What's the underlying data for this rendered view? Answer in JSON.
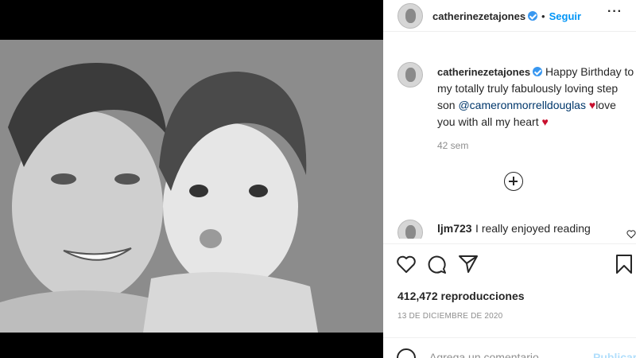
{
  "post": {
    "username": "catherinezetajones",
    "dot": "•",
    "follow_label": "Seguir",
    "more_label": "···",
    "caption_parts": {
      "text1": "Happy Birthday to my totally truly fabulously loving step son ",
      "mention": "@cameronmorrelldouglas",
      "text2": "love you with all my heart"
    },
    "time_ago": "42 sem"
  },
  "comments": [
    {
      "user": "ljm723",
      "text": "I really enjoyed reading"
    }
  ],
  "stats": {
    "views": "412,472 reproducciones",
    "date": "13 DE DICIEMBRE DE 2020"
  },
  "add_comment": {
    "placeholder": "Agrega un comentario...",
    "post_label": "Publicar"
  },
  "icons": {
    "like": "heart-outline-icon",
    "comment": "comment-bubble-icon",
    "share": "paper-plane-icon",
    "save": "bookmark-icon",
    "mute": "speaker-muted-icon",
    "verified": "verified-badge-icon",
    "load_more": "plus-circle-icon"
  },
  "colors": {
    "follow_blue": "#0095f6",
    "verified_blue": "#3897f0",
    "mention": "#00376b",
    "heart_red": "#c8102e",
    "muted_text": "#8e8e8e"
  }
}
